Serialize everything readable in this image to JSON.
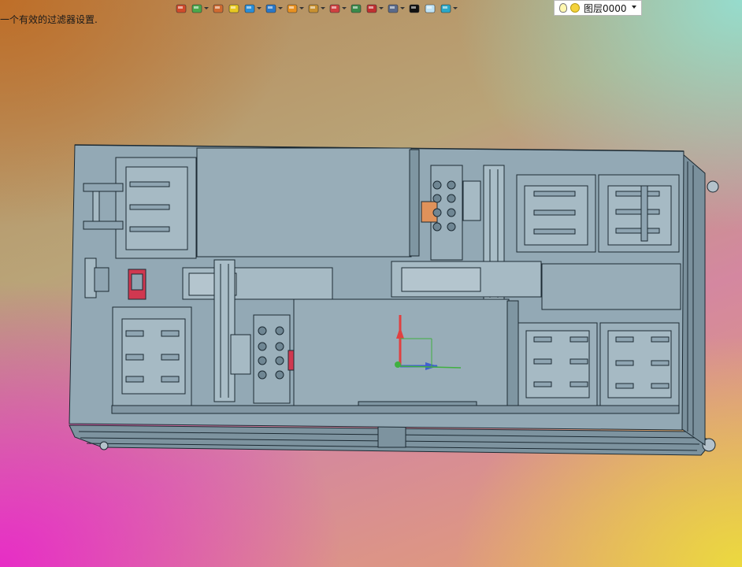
{
  "status": {
    "message": "一个有效的过滤器设置."
  },
  "toolbar": {
    "tools": [
      {
        "icon": "insert-icon",
        "dropdown": false,
        "color": "#d04a2a"
      },
      {
        "icon": "snap-icon",
        "dropdown": true,
        "color": "#4aa84a"
      },
      {
        "icon": "pencil-icon",
        "dropdown": false,
        "color": "#d06a30"
      },
      {
        "icon": "box-yellow-icon",
        "dropdown": false,
        "color": "#e8c820"
      },
      {
        "icon": "box-blue-icon",
        "dropdown": true,
        "color": "#2a8ed8"
      },
      {
        "icon": "view-cube-icon",
        "dropdown": true,
        "color": "#2a78c8"
      },
      {
        "icon": "render-wheel-icon",
        "dropdown": true,
        "color": "#e89020"
      },
      {
        "icon": "zoom-window-icon",
        "dropdown": true,
        "color": "#c89030"
      },
      {
        "icon": "orbit-icon",
        "dropdown": true,
        "color": "#d04040"
      },
      {
        "icon": "frame-icon",
        "dropdown": false,
        "color": "#3a8a4a"
      },
      {
        "icon": "dimension-icon",
        "dropdown": true,
        "color": "#c03030"
      },
      {
        "icon": "monitor-icon",
        "dropdown": true,
        "color": "#5a6a8a"
      },
      {
        "icon": "line-color-icon",
        "dropdown": false,
        "color": "#111111"
      },
      {
        "icon": "fill-color-icon",
        "dropdown": false,
        "color": "#bfe3f5"
      },
      {
        "icon": "layers-icon",
        "dropdown": true,
        "color": "#2aa8c8"
      }
    ],
    "layer": {
      "name": "图层0000"
    }
  },
  "colors": {
    "model_fill": "#8fa5b2",
    "model_light": "#a8bcc7",
    "model_dark": "#6f8693",
    "edge": "#1c2a33",
    "accent_orange": "#e0925a",
    "accent_red": "#d03850",
    "axis_red": "#e04040",
    "axis_green": "#40b040",
    "axis_blue": "#4060d0"
  }
}
